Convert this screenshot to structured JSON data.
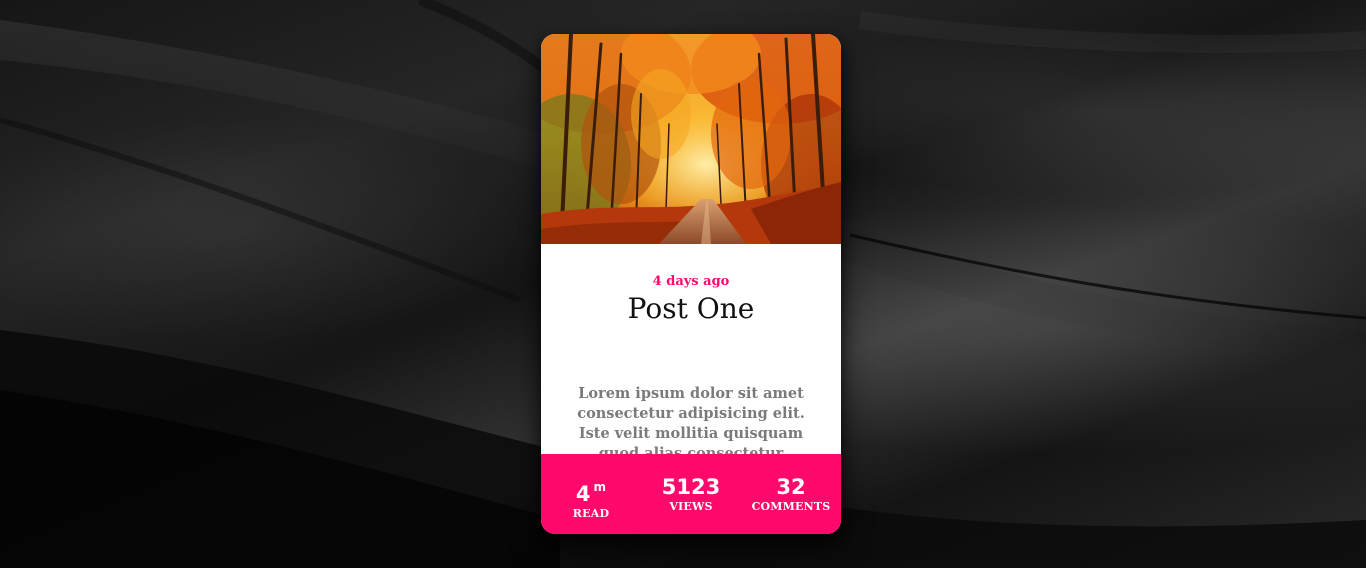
{
  "card": {
    "date": "4 days ago",
    "title": "Post One",
    "excerpt": "Lorem ipsum dolor sit amet consectetur adipisicing elit. Iste velit mollitia quisquam quod alias consectetur",
    "image_icon": "autumn-forest-road-image"
  },
  "stats": [
    {
      "value": "4",
      "unit": "m",
      "label": "READ"
    },
    {
      "value": "5123",
      "unit": "",
      "label": "VIEWS"
    },
    {
      "value": "32",
      "unit": "",
      "label": "COMMENTS"
    }
  ],
  "colors": {
    "accent": "#ff0a6c",
    "card_bg": "#ffffff",
    "excerpt": "#7a7a7a",
    "title": "#111111"
  }
}
